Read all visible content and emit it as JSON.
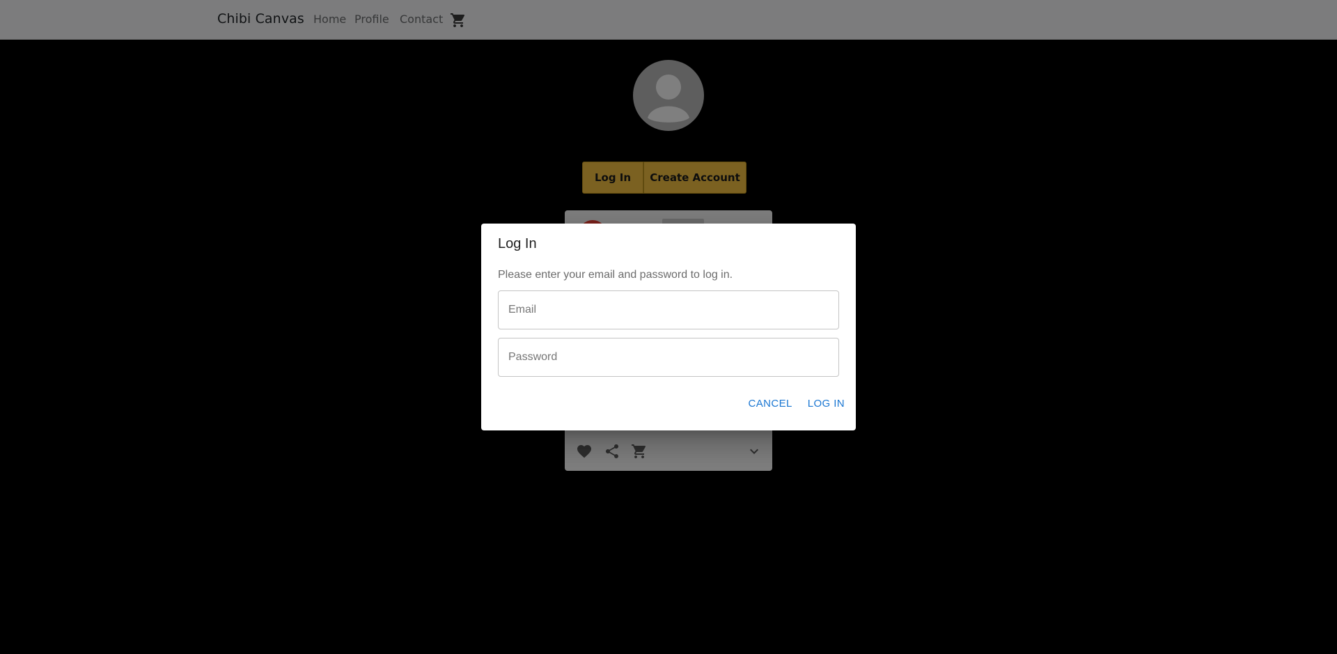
{
  "navbar": {
    "brand": "Chibi Canvas",
    "links": [
      "Home",
      "Profile",
      "Contact"
    ],
    "cart_icon": "shopping-cart-icon"
  },
  "profile": {
    "avatar_icon": "account-circle-icon",
    "login_label": "Log In",
    "create_account_label": "Create Account",
    "accent_color": "#f6c343"
  },
  "card": {
    "avatar_color": "#f44336",
    "action_icons": [
      "heart-icon",
      "share-icon",
      "shopping-cart-icon",
      "chevron-down-icon"
    ]
  },
  "dialog": {
    "title": "Log In",
    "description": "Please enter your email and password to log in.",
    "email_placeholder": "Email",
    "password_placeholder": "Password",
    "cancel_label": "CANCEL",
    "login_label": "LOG IN",
    "action_color": "#1976d2"
  }
}
